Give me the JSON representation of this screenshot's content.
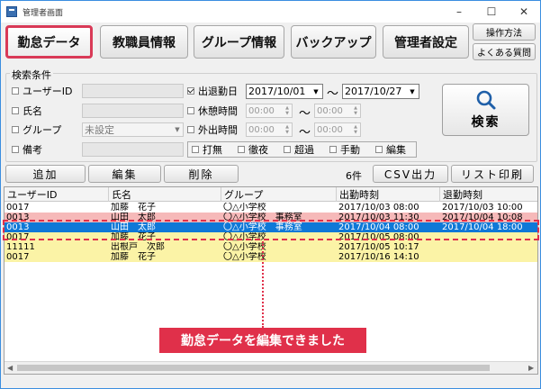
{
  "window": {
    "title": "管理者画面",
    "minimize": "–",
    "maximize": "☐",
    "close": "✕"
  },
  "tabs": [
    {
      "label": "勤怠データ"
    },
    {
      "label": "教職員情報"
    },
    {
      "label": "グループ情報"
    },
    {
      "label": "バックアップ"
    },
    {
      "label": "管理者設定"
    }
  ],
  "side_buttons": {
    "manual": "操作方法",
    "faq": "よくある質問"
  },
  "search": {
    "legend": "検索条件",
    "user_id_label": "ユーザーID",
    "name_label": "氏名",
    "group_label": "グループ",
    "group_value": "未設定",
    "remarks_label": "備考",
    "attendance_label": "出退勤日",
    "attendance_from": "2017/10/01",
    "attendance_to": "2017/10/27",
    "break_label": "休憩時間",
    "out_label": "外出時間",
    "time_placeholder": "00:00",
    "tilde": "〜",
    "flags": [
      "打無",
      "徹夜",
      "超過",
      "手動",
      "編集"
    ],
    "search_button": "検索"
  },
  "actions": {
    "add": "追加",
    "edit": "編集",
    "delete": "削除",
    "count": "6件",
    "csv": "CSV出力",
    "print": "リスト印刷"
  },
  "grid": {
    "columns": [
      "ユーザーID",
      "氏名",
      "グループ",
      "出勤時刻",
      "退勤時刻"
    ],
    "rows": [
      {
        "id": "0017",
        "name": "加藤　花子",
        "group": "〇△小学校",
        "in": "2017/10/03 08:00",
        "out": "2017/10/03 10:00",
        "color": "#ffffff"
      },
      {
        "id": "0013",
        "name": "山田　太郎",
        "group": "〇△小学校　事務室",
        "in": "2017/10/03 11:30",
        "out": "2017/10/04 10:08",
        "color": "#f6b9b9"
      },
      {
        "id": "0013",
        "name": "山田　太郎",
        "group": "〇△小学校　事務室",
        "in": "2017/10/04 08:00",
        "out": "2017/10/04 18:00",
        "color": "#0f78d7"
      },
      {
        "id": "0017",
        "name": "加藤　花子",
        "group": "〇△小学校",
        "in": "2017/10/05 08:00",
        "out": "",
        "color": "#fbf3a6"
      },
      {
        "id": "11111",
        "name": "出根戸　次郎",
        "group": "〇△小学校",
        "in": "2017/10/05 10:17",
        "out": "",
        "color": "#fbf3a6"
      },
      {
        "id": "0017",
        "name": "加藤　花子",
        "group": "〇△小学校",
        "in": "2017/10/16 14:10",
        "out": "",
        "color": "#fbf3a6"
      }
    ]
  },
  "callout": {
    "text": "勤怠データを編集できました"
  },
  "colors": {
    "accent": "#e0304a",
    "selected_row": "#0f78d7"
  }
}
